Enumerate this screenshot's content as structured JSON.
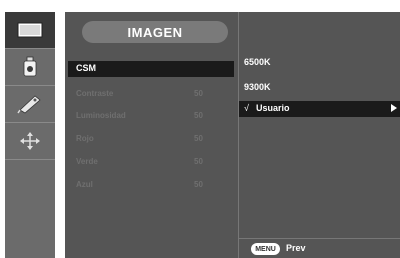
{
  "menu": {
    "title": "IMAGEN",
    "selected_item": "CSM",
    "parameters": [
      {
        "label": "Contraste",
        "value": "50"
      },
      {
        "label": "Luminosidad",
        "value": "50"
      },
      {
        "label": "Rojo",
        "value": "50"
      },
      {
        "label": "Verde",
        "value": "50"
      },
      {
        "label": "Azul",
        "value": "50"
      }
    ]
  },
  "submenu": {
    "options": [
      "6500K",
      "9300K"
    ],
    "selected_option": "Usuario",
    "check_mark": "√"
  },
  "footer": {
    "menu_button": "MENU",
    "prev_label": "Prev"
  },
  "sidebar": {
    "icons": [
      "monitor-picture-icon",
      "color-bottle-icon",
      "pen-tag-icon",
      "arrows-position-icon"
    ]
  }
}
